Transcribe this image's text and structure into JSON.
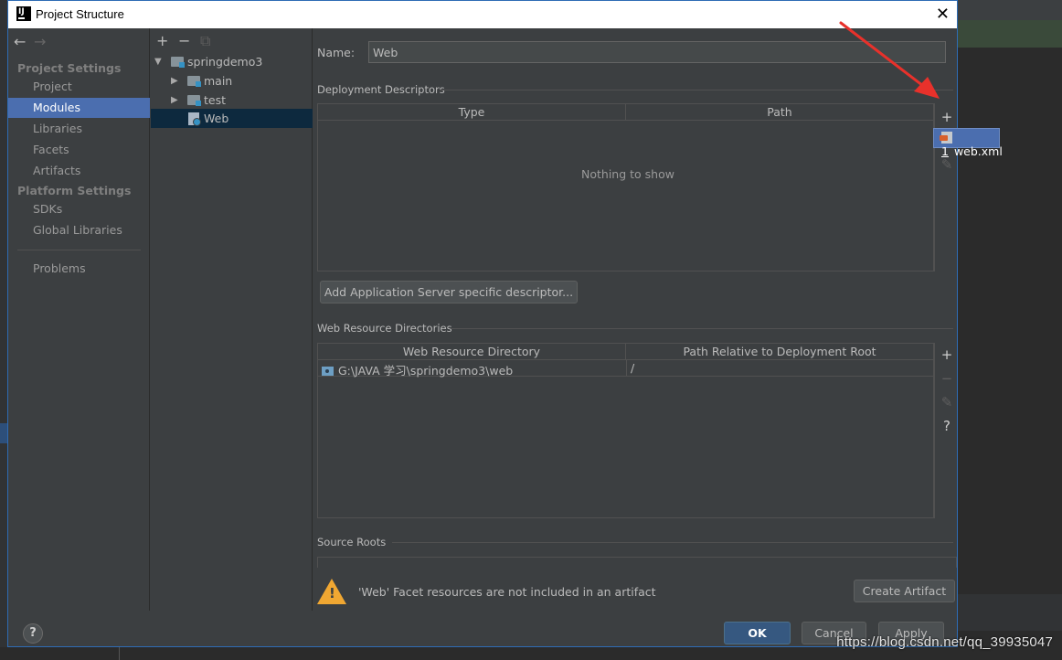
{
  "window": {
    "title": "Project Structure",
    "app_icon_text": "IJ",
    "close_glyph": "✕"
  },
  "nav": {
    "back": "←",
    "forward": "→"
  },
  "sidebar": {
    "project_settings_title": "Project Settings",
    "project_items": [
      "Project",
      "Modules",
      "Libraries",
      "Facets",
      "Artifacts"
    ],
    "platform_settings_title": "Platform Settings",
    "platform_items": [
      "SDKs",
      "Global Libraries"
    ],
    "problems": "Problems",
    "selected": "Modules"
  },
  "tree": {
    "toolbar": {
      "add": "+",
      "remove": "−",
      "copy": "⧉"
    },
    "root": "springdemo3",
    "children": [
      "main",
      "test"
    ],
    "web": "Web"
  },
  "form": {
    "name_label": "Name:",
    "name_value": "Web"
  },
  "deployment": {
    "title": "Deployment Descriptors",
    "columns": [
      "Type",
      "Path"
    ],
    "empty": "Nothing to show",
    "add_button": "Add Application Server specific descriptor..."
  },
  "popup": {
    "number": "1",
    "label": "web.xml"
  },
  "web_resources": {
    "title": "Web Resource Directories",
    "columns": [
      "Web Resource Directory",
      "Path Relative to Deployment Root"
    ],
    "rows": [
      {
        "directory": "G:\\JAVA 学习\\springdemo3\\web",
        "relative": "/"
      }
    ]
  },
  "side_tools": {
    "add": "+",
    "remove": "−",
    "edit": "✎",
    "help": "?"
  },
  "source_roots": {
    "title": "Source Roots"
  },
  "warning": {
    "text": "'Web' Facet resources are not included in an artifact",
    "button": "Create Artifact"
  },
  "footer": {
    "help": "?",
    "ok": "OK",
    "cancel": "Cancel",
    "apply": "Apply"
  },
  "watermark": "https://blog.csdn.net/qq_39935047",
  "colors": {
    "selection": "#4b6eaf",
    "accent_arrow": "#e8312b",
    "warning": "#f0a732",
    "dialog_bg": "#3c3f41"
  }
}
